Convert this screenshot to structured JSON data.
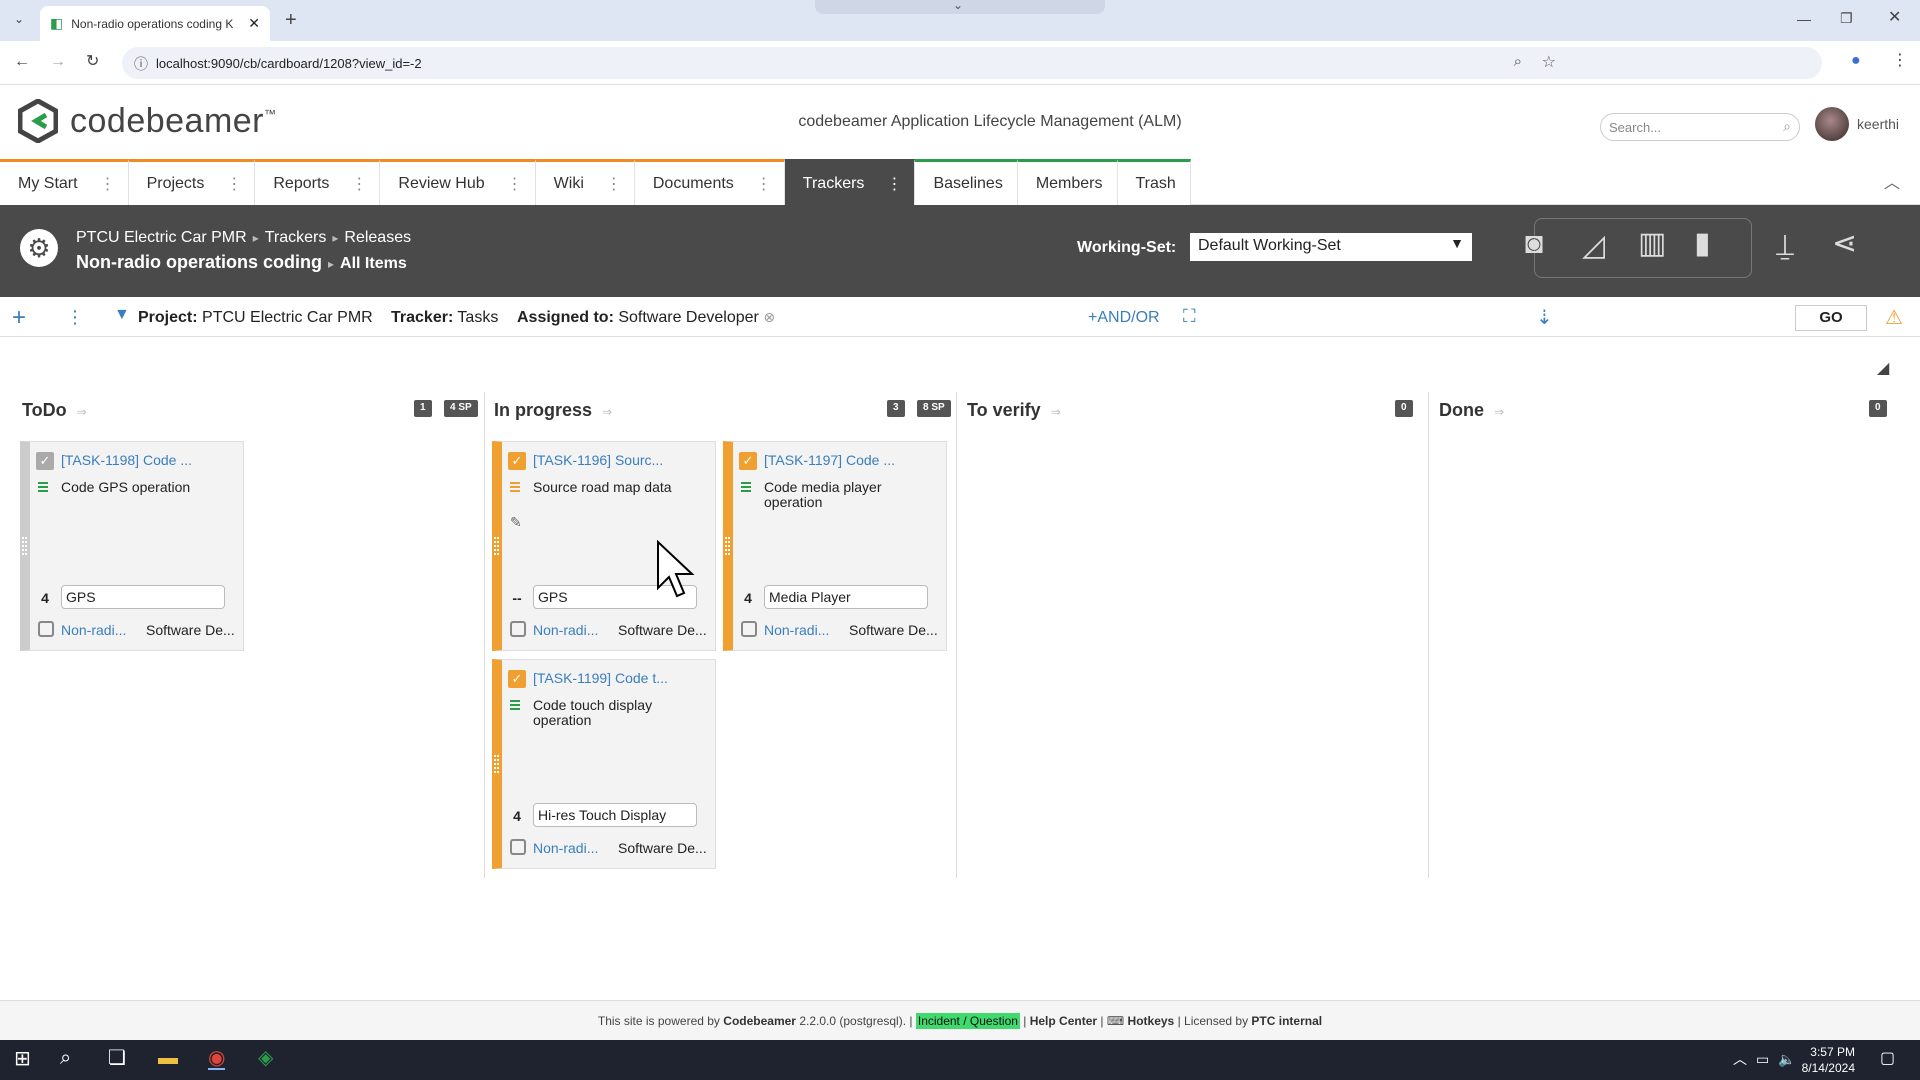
{
  "browser": {
    "tab_title": "Non-radio operations coding K",
    "url": "localhost:9090/cb/cardboard/1208?view_id=-2"
  },
  "header": {
    "logo_text": "codebeamer",
    "logo_tm": "™",
    "app_title": "codebeamer Application Lifecycle Management (ALM)",
    "search_placeholder": "Search...",
    "username": "keerthi"
  },
  "nav": {
    "items": [
      {
        "label": "My Start"
      },
      {
        "label": "Projects"
      },
      {
        "label": "Reports"
      },
      {
        "label": "Review Hub"
      },
      {
        "label": "Wiki"
      },
      {
        "label": "Documents"
      },
      {
        "label": "Trackers"
      },
      {
        "label": "Baselines"
      },
      {
        "label": "Members"
      },
      {
        "label": "Trash"
      }
    ],
    "active": "Trackers"
  },
  "breadcrumb": {
    "project": "PTCU Electric Car PMR",
    "trackers": "Trackers",
    "releases": "Releases",
    "tracker_name": "Non-radio operations coding",
    "view": "All Items"
  },
  "working_set": {
    "label": "Working-Set:",
    "value": "Default Working-Set"
  },
  "filter": {
    "project_label": "Project:",
    "project_value": "PTCU Electric Car PMR",
    "tracker_label": "Tracker:",
    "tracker_value": "Tasks",
    "assigned_label": "Assigned to:",
    "assigned_value": "Software Developer",
    "andor": "+AND/OR",
    "go": "GO"
  },
  "board": {
    "columns": [
      {
        "name": "ToDo",
        "count": "1",
        "sp": "4 SP"
      },
      {
        "name": "In progress",
        "count": "3",
        "sp": "8 SP"
      },
      {
        "name": "To verify",
        "count": "0",
        "sp": ""
      },
      {
        "name": "Done",
        "count": "0",
        "sp": ""
      }
    ],
    "cards": [
      {
        "key": "[TASK-1198] Code ...",
        "summary": "Code GPS operation",
        "points": "4",
        "component": "GPS",
        "project": "Non-radi...",
        "assignee": "Software De...",
        "color": "#cccccc"
      },
      {
        "key": "[TASK-1196] Sourc...",
        "summary": "Source road map data",
        "points": "--",
        "component": "GPS",
        "project": "Non-radi...",
        "assignee": "Software De...",
        "color": "#f0a030"
      },
      {
        "key": "[TASK-1197] Code ...",
        "summary": "Code media player operation",
        "points": "4",
        "component": "Media Player",
        "project": "Non-radi...",
        "assignee": "Software De...",
        "color": "#f0a030"
      },
      {
        "key": "[TASK-1199] Code t...",
        "summary": "Code touch display operation",
        "points": "4",
        "component": "Hi-res Touch Display",
        "project": "Non-radi...",
        "assignee": "Software De...",
        "color": "#f0a030"
      }
    ]
  },
  "footer": {
    "prefix": "This site is powered by",
    "product": "Codebeamer",
    "version": "2.2.0.0 (postgresql).",
    "incident": "Incident / Question",
    "help": "Help Center",
    "hotkeys": "Hotkeys",
    "licensed": "Licensed by",
    "licensee": "PTC internal"
  },
  "taskbar": {
    "time": "3:57 PM",
    "date": "8/14/2024"
  }
}
